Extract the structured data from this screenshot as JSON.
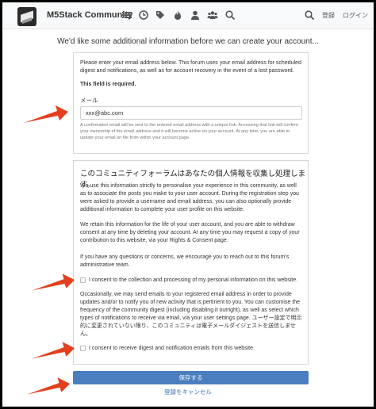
{
  "navbar": {
    "brand": "M5Stack Community",
    "register": "登録",
    "login": "ログイン"
  },
  "icons": [
    "menu-list-icon",
    "clock-icon",
    "tags-icon",
    "flame-icon",
    "user-icon",
    "group-icon",
    "search-icon"
  ],
  "subtitle": "We'd like some additional information before we can create your account...",
  "email_panel": {
    "intro": "Please enter your email address below. This forum uses your email address for scheduled digest and notifications, as well as for account recovery in the event of a lost password.",
    "required": "This field is required.",
    "label": "メール",
    "value": "xxx@abc.com",
    "help": "A confirmation email will be sent to the entered email address with a unique link. Accessing that link will confirm your ownership of the email address and it will become active on your account. At any time, you are able to update your email on file from within your account page."
  },
  "consent_panel": {
    "title": "このコミュニティフォーラムはあなたの個人情報を収集し処理します。",
    "p1": "We use this information strictly to personalise your experience in this community, as well as to associate the posts you make to your user account. During the registration step you were asked to provide a username and email address, you can also optionally provide additional information to complete your user profile on this website.",
    "p2": "We retain this information for the life of your user account, and you are able to withdraw consent at any time by deleting your account. At any time you may request a copy of your contribution to this website, via your Rights & Consent page.",
    "p3": "If you have any questions or concerns, we encourage you to reach out to this forum's administrative team.",
    "consent1": "I consent to the collection and processing of my personal information on this website.",
    "p4": "Occasionally, we may send emails to your registered email address in order to provide updates and/or to notify you of new activity that is pertinent to you. You can customise the frequency of the community digest (including disabling it outright), as well as select which types of notifications to receive via email, via your user settings page. ユーザー設定で明示的に変更されていない限り、このコミュニティは電子メールダイジェストを送信しません。",
    "consent2": "I consent to receive digest and notification emails from this website."
  },
  "buttons": {
    "save": "保存する",
    "cancel": "登録をキャンセル"
  },
  "colors": {
    "accent": "#4a7ebf",
    "link": "#3a74b8",
    "annotation_arrow": "#e2401f"
  }
}
